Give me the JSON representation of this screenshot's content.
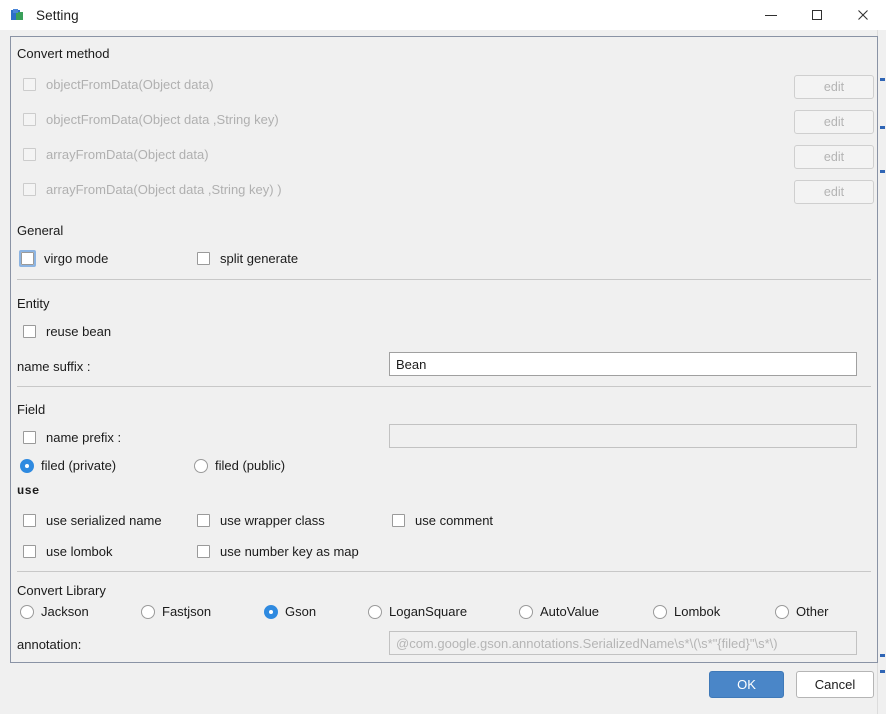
{
  "window": {
    "title": "Setting",
    "icon": "app-icon",
    "controls": {
      "minimize": "minimize-icon",
      "maximize": "maximize-icon",
      "close": "close-icon"
    }
  },
  "sections": {
    "convert_method": {
      "title": "Convert method",
      "items": [
        {
          "label": "objectFromData(Object data)",
          "checked": false,
          "disabled": true,
          "edit_label": "edit"
        },
        {
          "label": "objectFromData(Object data ,String key)",
          "checked": false,
          "disabled": true,
          "edit_label": "edit"
        },
        {
          "label": "arrayFromData(Object data)",
          "checked": false,
          "disabled": true,
          "edit_label": "edit"
        },
        {
          "label": "arrayFromData(Object data ,String key) )",
          "checked": false,
          "disabled": true,
          "edit_label": "edit"
        }
      ]
    },
    "general": {
      "title": "General",
      "items": [
        {
          "label": "virgo mode",
          "checked": false,
          "focused": true
        },
        {
          "label": "split generate",
          "checked": false,
          "focused": false
        }
      ]
    },
    "entity": {
      "title": "Entity",
      "reuse_bean": {
        "label": "reuse bean",
        "checked": false
      },
      "name_suffix": {
        "label": "name suffix :",
        "value": "Bean",
        "placeholder": ""
      }
    },
    "field": {
      "title": "Field",
      "name_prefix": {
        "label": "name prefix :",
        "checked": false,
        "value": "",
        "placeholder": "",
        "disabled": true
      },
      "visibility": {
        "options": [
          {
            "label": "filed (private)",
            "selected": true
          },
          {
            "label": "filed (public)",
            "selected": false
          }
        ]
      },
      "use_title": "use",
      "use_items": [
        {
          "label": "use serialized name",
          "checked": false
        },
        {
          "label": "use wrapper class",
          "checked": false
        },
        {
          "label": "use comment",
          "checked": false
        },
        {
          "label": "use lombok",
          "checked": false
        },
        {
          "label": "use number key as map",
          "checked": false
        }
      ]
    },
    "convert_library": {
      "title": "Convert Library",
      "options": [
        {
          "label": "Jackson",
          "selected": false
        },
        {
          "label": "Fastjson",
          "selected": false
        },
        {
          "label": "Gson",
          "selected": true
        },
        {
          "label": "LoganSquare",
          "selected": false
        },
        {
          "label": "AutoValue",
          "selected": false
        },
        {
          "label": "Lombok",
          "selected": false
        },
        {
          "label": "Other",
          "selected": false
        }
      ],
      "annotation": {
        "label": "annotation:",
        "value": "@com.google.gson.annotations.SerializedName\\s*\\(\\s*\"{filed}\"\\s*\\)",
        "disabled": true
      }
    }
  },
  "footer": {
    "ok_label": "OK",
    "cancel_label": "Cancel"
  },
  "colors": {
    "accent": "#2f8ae0",
    "ok_button": "#4a86c8",
    "panel_border": "#8a93a5",
    "window_bg": "#f0f0f0"
  }
}
